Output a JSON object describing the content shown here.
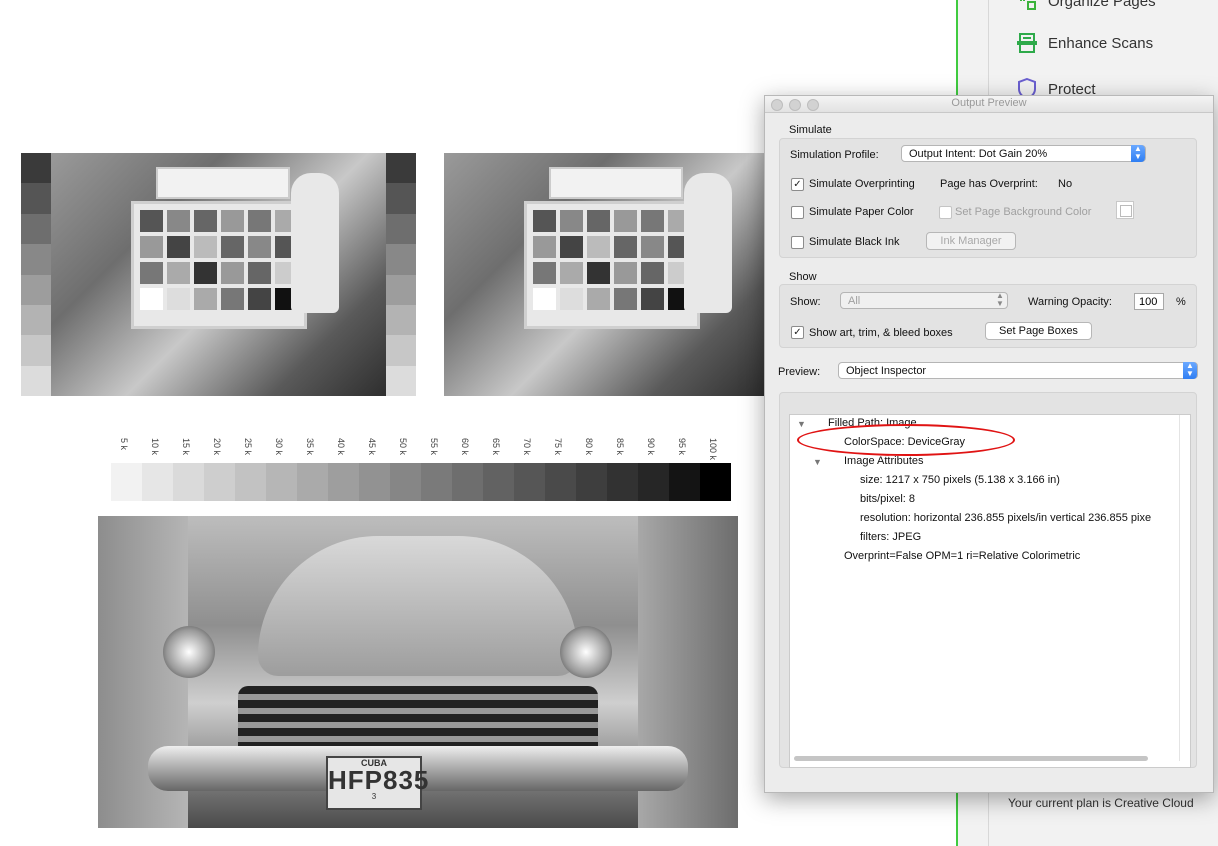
{
  "right_panel": {
    "tools": [
      {
        "label": "Organize Pages",
        "icon": "organize-pages-icon"
      },
      {
        "label": "Enhance Scans",
        "icon": "enhance-scans-icon"
      },
      {
        "label": "Protect",
        "icon": "shield-icon"
      }
    ],
    "plan_text": "Your current plan is Creative Cloud",
    "accent_color": "#3fcb3f"
  },
  "scale_labels": [
    "5 k",
    "10 k",
    "15 k",
    "20 k",
    "25 k",
    "30 k",
    "35 k",
    "40 k",
    "45 k",
    "50 k",
    "55 k",
    "60 k",
    "65 k",
    "70 k",
    "75 k",
    "80 k",
    "85 k",
    "90 k",
    "95 k",
    "100 k"
  ],
  "car": {
    "plate_top": "CUBA",
    "plate_number": "HFP835",
    "plate_small": "3"
  },
  "output_preview": {
    "title": "Output Preview",
    "simulate": {
      "section_label": "Simulate",
      "profile_label": "Simulation Profile:",
      "profile_value": "Output Intent: Dot Gain 20%",
      "simulate_overprinting": {
        "label": "Simulate Overprinting",
        "checked": "✓"
      },
      "page_has_overprint_label": "Page has Overprint:",
      "page_has_overprint_value": "No",
      "simulate_paper_color": {
        "label": "Simulate Paper Color",
        "checked": ""
      },
      "set_page_bg_label": "Set Page Background Color",
      "simulate_black_ink": {
        "label": "Simulate Black Ink",
        "checked": ""
      },
      "ink_manager_label": "Ink Manager"
    },
    "show": {
      "section_label": "Show",
      "show_label": "Show:",
      "show_value": "All",
      "warning_opacity_label": "Warning Opacity:",
      "warning_opacity_value": "100",
      "percent": "%",
      "show_boxes": {
        "label": "Show art, trim, & bleed boxes",
        "checked": "✓"
      },
      "set_page_boxes_label": "Set Page Boxes"
    },
    "preview": {
      "label": "Preview:",
      "value": "Object Inspector"
    },
    "inspector": {
      "rows": [
        "Filled Path: Image",
        "ColorSpace: DeviceGray",
        "Image Attributes",
        "size: 1217 x 750 pixels (5.138 x 3.166 in)",
        "bits/pixel: 8",
        "resolution: horizontal 236.855 pixels/in vertical 236.855 pixe",
        "filters: JPEG",
        "Overprint=False OPM=1 ri=Relative Colorimetric"
      ]
    },
    "annotation_color": "#e01313"
  }
}
